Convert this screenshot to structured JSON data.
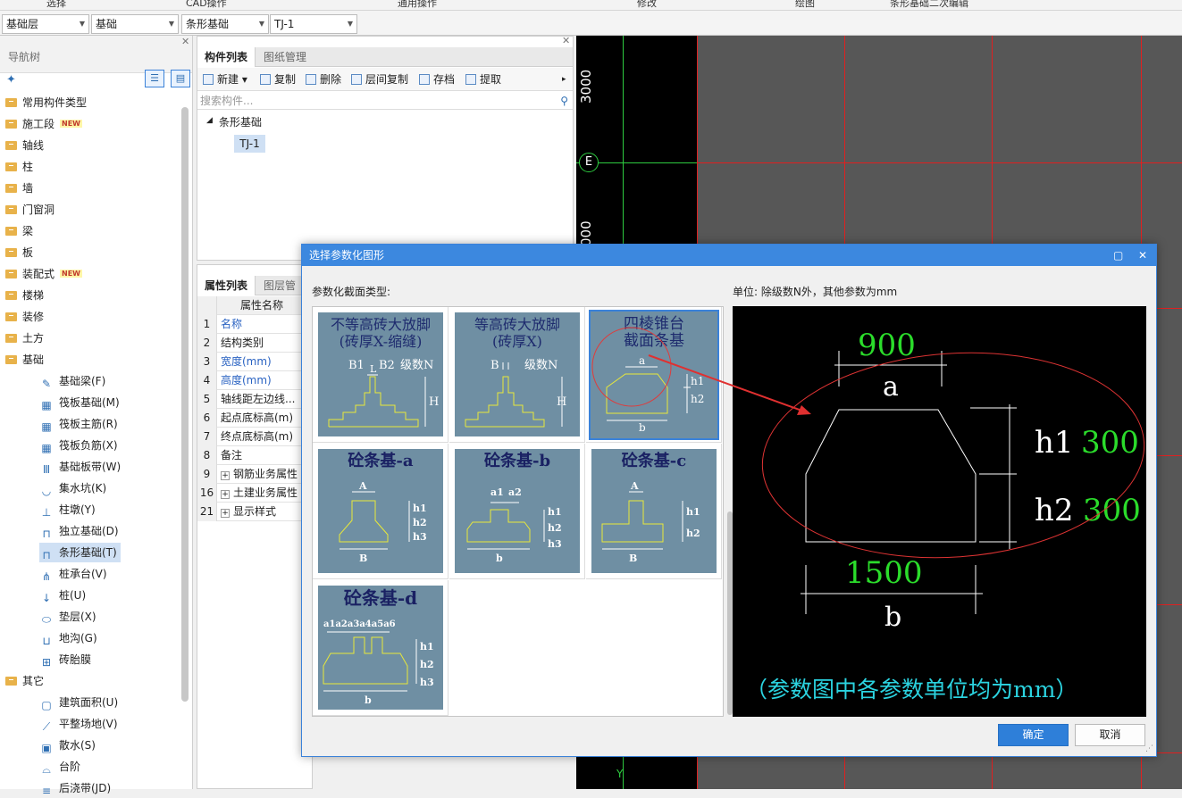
{
  "top_menu": [
    "选择",
    "CAD操作",
    "通用操作",
    "修改",
    "绘图",
    "条形基础二次编辑"
  ],
  "toolbar": {
    "combos": [
      "基础层",
      "基础",
      "条形基础",
      "TJ-1"
    ]
  },
  "nav": {
    "title": "导航树",
    "items": [
      {
        "label": "常用构件类型",
        "type": "folder"
      },
      {
        "label": "施工段",
        "type": "folder",
        "badge": "NEW"
      },
      {
        "label": "轴线",
        "type": "folder"
      },
      {
        "label": "柱",
        "type": "folder"
      },
      {
        "label": "墙",
        "type": "folder"
      },
      {
        "label": "门窗洞",
        "type": "folder"
      },
      {
        "label": "梁",
        "type": "folder"
      },
      {
        "label": "板",
        "type": "folder"
      },
      {
        "label": "装配式",
        "type": "folder",
        "badge": "NEW"
      },
      {
        "label": "楼梯",
        "type": "folder"
      },
      {
        "label": "装修",
        "type": "folder"
      },
      {
        "label": "土方",
        "type": "folder"
      },
      {
        "label": "基础",
        "type": "folder-open"
      },
      {
        "label": "基础梁(F)",
        "type": "sub",
        "icon": "✎"
      },
      {
        "label": "筏板基础(M)",
        "type": "sub",
        "icon": "▦"
      },
      {
        "label": "筏板主筋(R)",
        "type": "sub",
        "icon": "▦"
      },
      {
        "label": "筏板负筋(X)",
        "type": "sub",
        "icon": "▦"
      },
      {
        "label": "基础板带(W)",
        "type": "sub",
        "icon": "Ⅲ"
      },
      {
        "label": "集水坑(K)",
        "type": "sub",
        "icon": "◡"
      },
      {
        "label": "柱墩(Y)",
        "type": "sub",
        "icon": "⊥"
      },
      {
        "label": "独立基础(D)",
        "type": "sub",
        "icon": "⊓"
      },
      {
        "label": "条形基础(T)",
        "type": "sub",
        "icon": "⊓",
        "selected": true
      },
      {
        "label": "桩承台(V)",
        "type": "sub",
        "icon": "⋔"
      },
      {
        "label": "桩(U)",
        "type": "sub",
        "icon": "↓"
      },
      {
        "label": "垫层(X)",
        "type": "sub",
        "icon": "⬭"
      },
      {
        "label": "地沟(G)",
        "type": "sub",
        "icon": "⊔"
      },
      {
        "label": "砖胎膜",
        "type": "sub",
        "icon": "⊞"
      },
      {
        "label": "其它",
        "type": "folder-open"
      },
      {
        "label": "建筑面积(U)",
        "type": "sub",
        "icon": "▢"
      },
      {
        "label": "平整场地(V)",
        "type": "sub",
        "icon": "⟋"
      },
      {
        "label": "散水(S)",
        "type": "sub",
        "icon": "▣"
      },
      {
        "label": "台阶",
        "type": "sub",
        "icon": "⌓"
      },
      {
        "label": "后浇带(JD)",
        "type": "sub",
        "icon": "≡"
      }
    ]
  },
  "component_panel": {
    "tabs": [
      "构件列表",
      "图纸管理"
    ],
    "toolbar": [
      "新建",
      "复制",
      "删除",
      "层间复制",
      "存档",
      "提取"
    ],
    "search_placeholder": "搜索构件...",
    "tree_root": "条形基础",
    "tree_item": "TJ-1"
  },
  "property_panel": {
    "tabs": [
      "属性列表",
      "图层管理"
    ],
    "header": "属性名称",
    "rows": [
      {
        "n": "1",
        "label": "名称",
        "blue": true
      },
      {
        "n": "2",
        "label": "结构类别"
      },
      {
        "n": "3",
        "label": "宽度(mm)",
        "blue": true
      },
      {
        "n": "4",
        "label": "高度(mm)",
        "blue": true
      },
      {
        "n": "5",
        "label": "轴线距左边线..."
      },
      {
        "n": "6",
        "label": "起点底标高(m)"
      },
      {
        "n": "7",
        "label": "终点底标高(m)"
      },
      {
        "n": "8",
        "label": "备注"
      },
      {
        "n": "9",
        "label": "钢筋业务属性",
        "expand": true
      },
      {
        "n": "16",
        "label": "土建业务属性",
        "expand": true
      },
      {
        "n": "21",
        "label": "显示样式",
        "expand": true
      }
    ]
  },
  "cad": {
    "dim_top": "3000",
    "dim_mid": "000",
    "axis_label": "E",
    "axis_y": "Y"
  },
  "dialog": {
    "title": "选择参数化图形",
    "section_label": "参数化截面类型:",
    "unit_label": "单位:   除级数N外，其他参数为mm",
    "shapes": [
      {
        "title_lines": [
          "不等高砖大放脚",
          "(砖厚X-缩缝)"
        ],
        "labels": {
          "b1": "B1",
          "b2": "B2",
          "l": "L",
          "n": "级数N",
          "h": "H"
        }
      },
      {
        "title_lines": [
          "等高砖大放脚",
          "(砖厚X)"
        ],
        "labels": {
          "b": "B",
          "n": "级数N",
          "h": "H"
        }
      },
      {
        "title_lines": [
          "四棱锥台",
          "截面条基"
        ],
        "labels": {
          "a": "a",
          "h1": "h1",
          "h2": "h2",
          "b": "b"
        },
        "selected": true
      },
      {
        "title_lines": [
          "砼条基-a"
        ],
        "labels": {
          "a": "A",
          "h1": "h1",
          "h2": "h2",
          "h3": "h3",
          "b": "B"
        }
      },
      {
        "title_lines": [
          "砼条基-b"
        ],
        "labels": {
          "a1": "a1",
          "a2": "a2",
          "h1": "h1",
          "h2": "h2",
          "h3": "h3",
          "b": "b"
        }
      },
      {
        "title_lines": [
          "砼条基-c"
        ],
        "labels": {
          "a": "A",
          "h1": "h1",
          "h2": "h2",
          "b": "B"
        }
      },
      {
        "title_lines": [
          "砼条基-d"
        ],
        "labels": {
          "a": "a1a2a3a4a5a6",
          "h1": "h1",
          "h2": "h2",
          "h3": "h3",
          "b": "b"
        }
      }
    ],
    "preview": {
      "a_value": "900",
      "a_label": "a",
      "h1_label": "h1",
      "h1_value": "300",
      "h2_label": "h2",
      "h2_value": "300",
      "b_value": "1500",
      "b_label": "b",
      "note": "（参数图中各参数单位均为mm）"
    },
    "ok_label": "确定",
    "cancel_label": "取消"
  }
}
